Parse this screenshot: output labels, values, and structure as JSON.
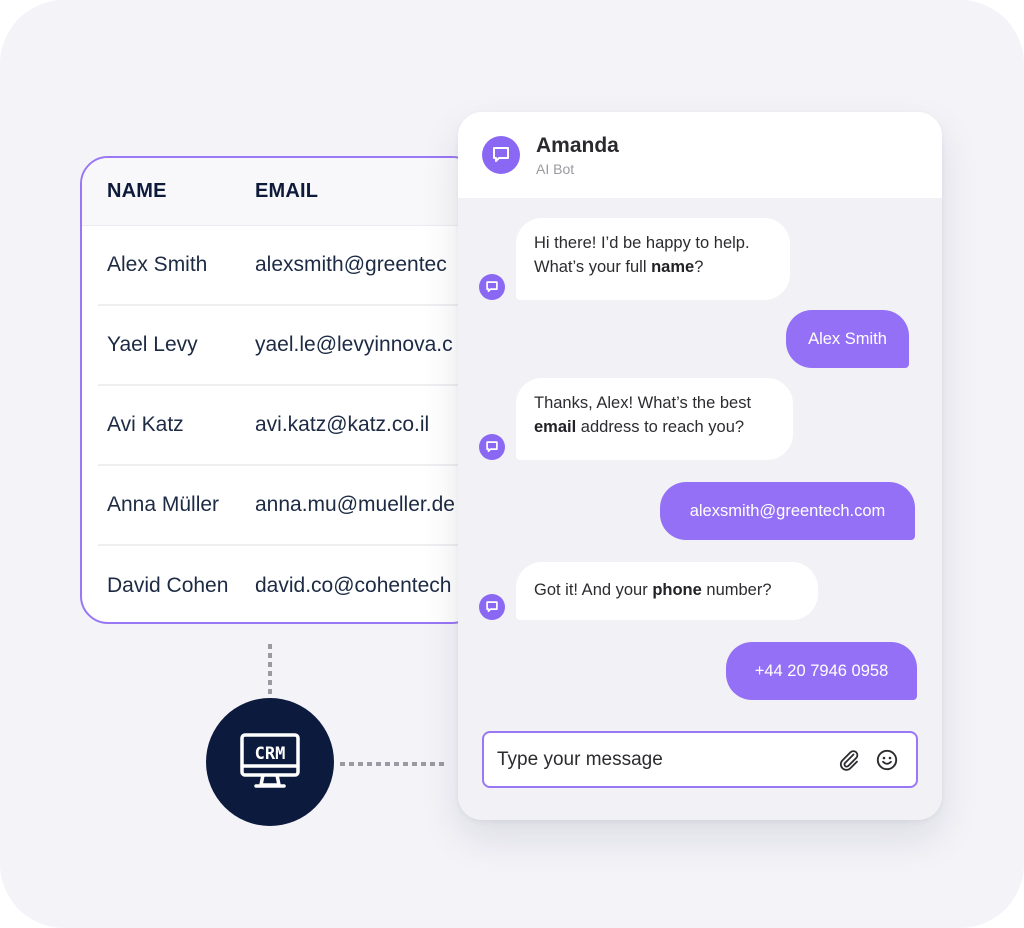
{
  "colors": {
    "accent": "#9470f6",
    "accent_border": "#9a77f5",
    "crm_badge": "#0b1a3d",
    "canvas_bg": "#f3f3f8"
  },
  "table": {
    "headers": [
      "NAME",
      "EMAIL"
    ],
    "rows": [
      {
        "name": "Alex Smith",
        "email": "alexsmith@greentec"
      },
      {
        "name": "Yael Levy",
        "email": "yael.le@levyinnova.c"
      },
      {
        "name": "Avi Katz",
        "email": "avi.katz@katz.co.il"
      },
      {
        "name": "Anna Müller",
        "email": "anna.mu@mueller.de"
      },
      {
        "name": "David Cohen",
        "email": "david.co@cohentech"
      }
    ]
  },
  "crm_badge": {
    "icon": "crm-monitor-icon",
    "label": "CRM"
  },
  "chat": {
    "header": {
      "name": "Amanda",
      "role": "AI Bot",
      "avatar_icon": "chat-bubble-icon"
    },
    "messages": [
      {
        "from": "bot",
        "parts": [
          "Hi there! I’d be happy to help.",
          "What’s your full ",
          "name",
          "?"
        ]
      },
      {
        "from": "user",
        "text": "Alex Smith"
      },
      {
        "from": "bot",
        "parts": [
          "Thanks, Alex! What’s the best",
          "email",
          " address to reach you?"
        ]
      },
      {
        "from": "user",
        "text": "alexsmith@greentech.com"
      },
      {
        "from": "bot",
        "parts": [
          "Got it! And your ",
          "phone",
          " number?"
        ]
      },
      {
        "from": "user",
        "text": "+44 20 7946 0958"
      }
    ],
    "composer": {
      "placeholder": "Type your message",
      "value": "",
      "attach_icon": "paperclip-icon",
      "emoji_icon": "smiley-icon"
    }
  }
}
